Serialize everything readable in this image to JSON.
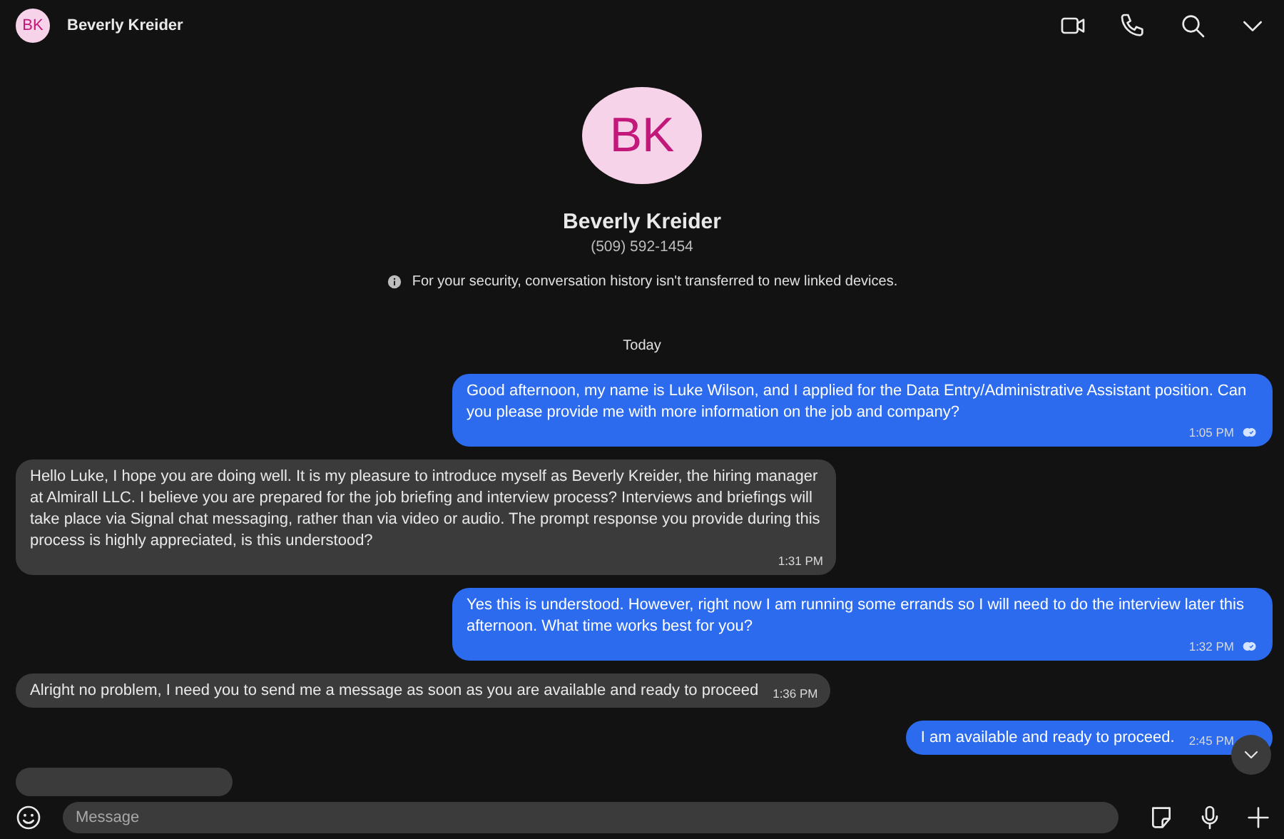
{
  "header": {
    "avatar_initials": "BK",
    "title": "Beverly Kreider"
  },
  "profile": {
    "avatar_initials": "BK",
    "name": "Beverly Kreider",
    "phone": "(509) 592-1454",
    "notice": "For your security, conversation history isn't transferred to new linked devices."
  },
  "date_divider": "Today",
  "messages": [
    {
      "kind": "outgoing",
      "text": "Good afternoon, my name is Luke Wilson, and I applied for the Data Entry/Administrative Assistant position. Can you please provide me with more information on the job and company?",
      "time": "1:05 PM",
      "read": true
    },
    {
      "kind": "incoming",
      "text": "Hello Luke, I hope you are doing well. It is my pleasure to introduce myself as Beverly Kreider, the hiring manager at Almirall LLC. I believe you are prepared for the job briefing and interview process? Interviews and briefings will take place via Signal chat messaging, rather than via video or audio. The prompt response you provide during this process is highly appreciated, is this understood?",
      "time": "1:31 PM"
    },
    {
      "kind": "outgoing",
      "text": "Yes this is understood. However, right now I am running some errands so I will need to do the interview later this afternoon. What time works best for you?",
      "time": "1:32 PM",
      "read": true
    },
    {
      "kind": "incoming",
      "text": "Alright no problem, I need you to send me a message as soon as you are available and ready to proceed",
      "time": "1:36 PM"
    },
    {
      "kind": "outgoing",
      "text": "I am available and ready to proceed.",
      "time": "2:45 PM"
    },
    {
      "kind": "incoming"
    }
  ],
  "composer": {
    "placeholder": "Message"
  }
}
